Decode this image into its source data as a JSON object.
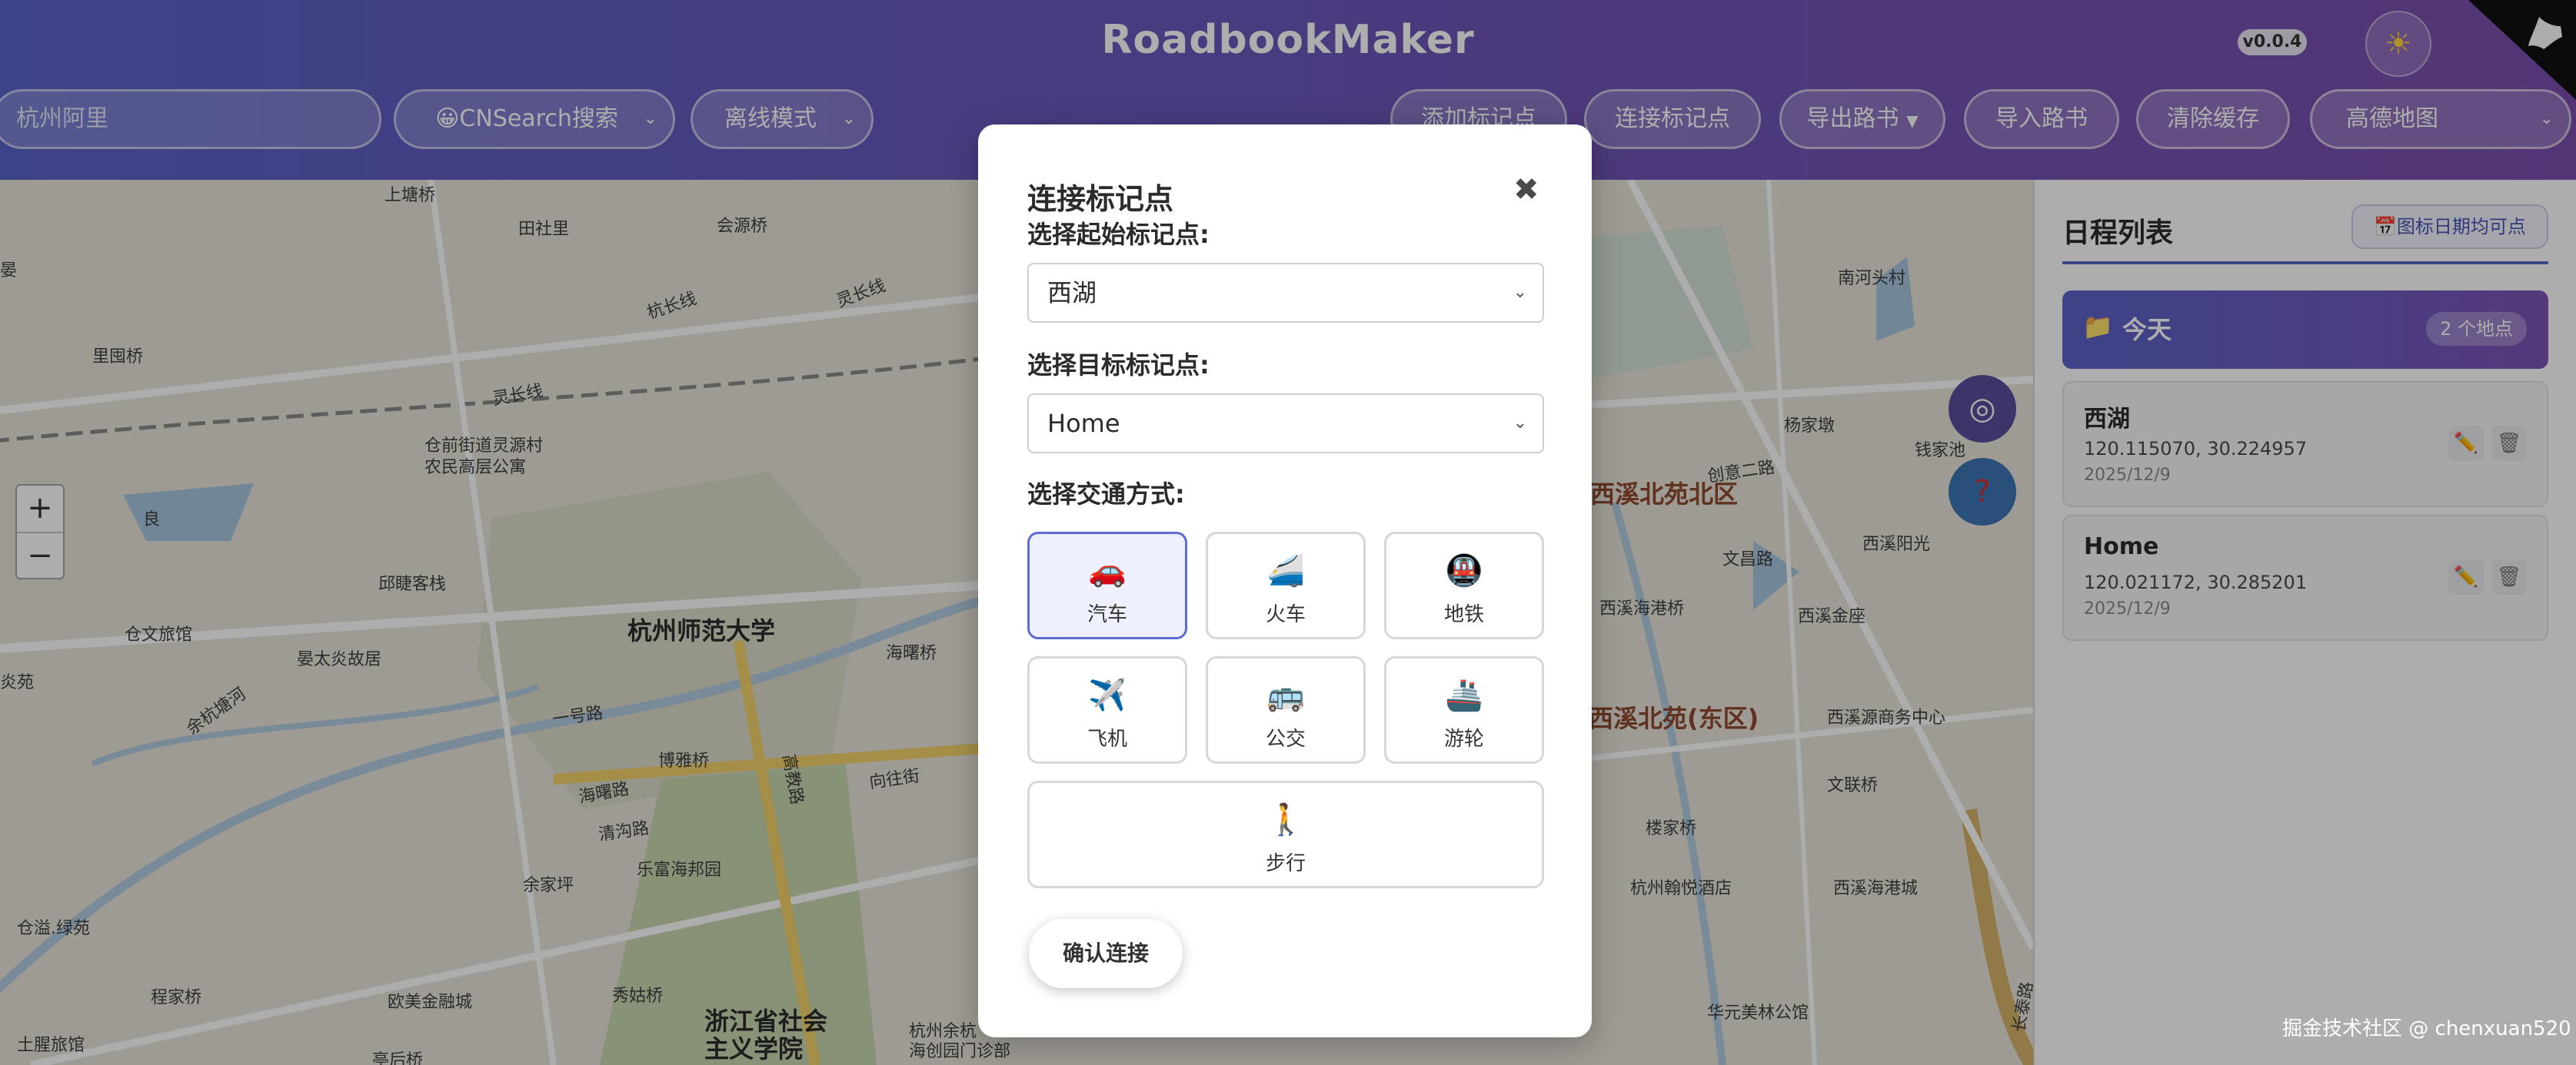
{
  "header": {
    "title": "RoadbookMaker",
    "version": "v0.0.4",
    "theme_icon": "sun-icon",
    "search_value": "杭州阿里",
    "search_engine": "😀CNSearch搜索",
    "offline_mode": "离线模式",
    "add_marker": "添加标记点",
    "connect_markers": "连接标记点",
    "export": "导出路书",
    "import": "导入路书",
    "clear_cache": "清除缓存",
    "map_provider": "高德地图"
  },
  "map": {
    "labels": [
      "上塘桥",
      "田社里",
      "会源桥",
      "杭长线",
      "灵长线",
      "灵长线",
      "里囤桥",
      "良",
      "仓前街道灵源村",
      "农民高层公寓",
      "邱睫客栈",
      "仓文旅馆",
      "晏太炎故居",
      "杭州师范大学",
      "海曙桥",
      "余杭塘河",
      "一号路",
      "博雅桥",
      "海曙路",
      "向往街",
      "高教路",
      "余家坪",
      "乐富海邦园",
      "清沟路",
      "仓溢.绿苑",
      "程家桥",
      "欧美金融城",
      "秀姑桥",
      "浙江省社会",
      "主义学院",
      "杭州余杭",
      "海创园门诊部",
      "土腥旅馆",
      "亭后桥",
      "南河头村",
      "杨家墩",
      "创意二路",
      "钱家池",
      "文昌路",
      "西溪阳光",
      "西溪北苑北区",
      "西溪海港桥",
      "西溪金座",
      "西溪北苑(东区)",
      "西溪源商务中心",
      "文联桥",
      "楼家桥",
      "杭州翰悦酒店",
      "西溪海港城",
      "华元美林公馆",
      "炎苑",
      "长泰路",
      "晏"
    ],
    "zoom_in": "+",
    "zoom_out": "−",
    "locate_icon": "target-icon",
    "help_icon": "question-icon"
  },
  "modal": {
    "title": "连接标记点",
    "close": "✖",
    "start_label": "选择起始标记点:",
    "start_value": "西湖",
    "target_label": "选择目标标记点:",
    "target_value": "Home",
    "transport_label": "选择交通方式:",
    "modes": [
      {
        "icon": "🚗",
        "label": "汽车",
        "selected": true
      },
      {
        "icon": "🚄",
        "label": "火车",
        "selected": false
      },
      {
        "icon": "🚇",
        "label": "地铁",
        "selected": false
      },
      {
        "icon": "✈️",
        "label": "飞机",
        "selected": false
      },
      {
        "icon": "🚌",
        "label": "公交",
        "selected": false
      },
      {
        "icon": "🚢",
        "label": "游轮",
        "selected": false
      },
      {
        "icon": "🚶",
        "label": "步行",
        "selected": false
      }
    ],
    "confirm": "确认连接"
  },
  "sidebar": {
    "title": "日程列表",
    "date_button": "📅图标日期均可点",
    "day": {
      "icon": "📁",
      "title": "今天",
      "count": "2 个地点"
    },
    "places": [
      {
        "name": "西湖",
        "coords": "120.115070, 30.224957",
        "date": "2025/12/9"
      },
      {
        "name": "Home",
        "coords": "120.021172, 30.285201",
        "date": "2025/12/9"
      }
    ],
    "edit_icon": "✏️",
    "delete_icon": "🗑"
  },
  "watermark": "掘金技术社区 @ chenxuan520",
  "colors": {
    "header_start": "#5b63c9",
    "header_end": "#7b4fae",
    "accent": "#5a6ed4",
    "area_label": "#8e4a2e"
  }
}
